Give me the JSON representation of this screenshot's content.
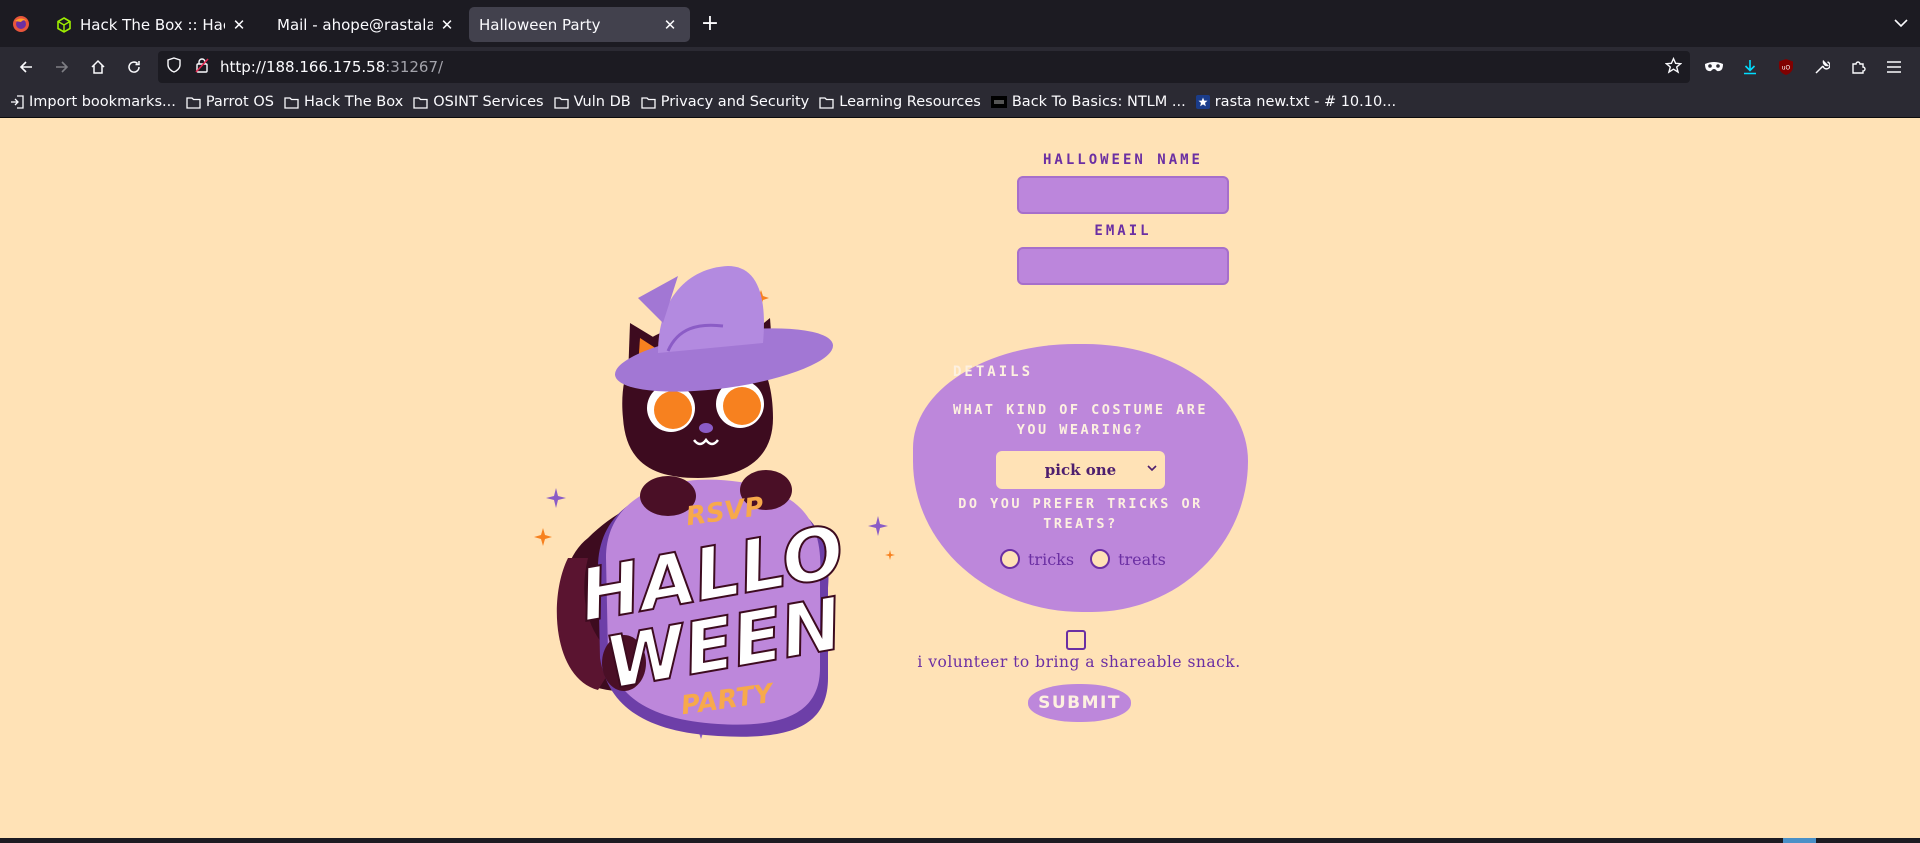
{
  "browser": {
    "tabs": [
      {
        "label": "Hack The Box :: Hack The Box",
        "icon": "hackthebox-cube-icon",
        "active": false
      },
      {
        "label": "Mail - ahope@rastalabs.local",
        "icon": "",
        "active": false
      },
      {
        "label": "Halloween Party",
        "icon": "",
        "active": true
      }
    ],
    "url_host": "http://188.166.175.58",
    "url_rest": ":31267/",
    "bookmarks": [
      {
        "label": "Import bookmarks...",
        "icon": "import-icon"
      },
      {
        "label": "Parrot OS",
        "icon": "folder-icon"
      },
      {
        "label": "Hack The Box",
        "icon": "folder-icon"
      },
      {
        "label": "OSINT Services",
        "icon": "folder-icon"
      },
      {
        "label": "Vuln DB",
        "icon": "folder-icon"
      },
      {
        "label": "Privacy and Security",
        "icon": "folder-icon"
      },
      {
        "label": "Learning Resources",
        "icon": "folder-icon"
      },
      {
        "label": "Back To Basics: NTLM ...",
        "icon": "site-icon"
      },
      {
        "label": "rasta new.txt - # 10.10...",
        "icon": "star-site-icon"
      }
    ]
  },
  "page": {
    "illustration": {
      "rsvp": "RSVP",
      "line1": "HALLO",
      "line2": "WEEN",
      "party": "PARTY"
    },
    "form": {
      "name_label": "HALLOWEEN NAME",
      "email_label": "EMAIL",
      "details_title": "DETAILS",
      "costume_question": "WHAT KIND OF COSTUME ARE YOU WEARING?",
      "costume_selected": "pick one",
      "preference_question": "DO YOU PREFER TRICKS OR TREATS?",
      "radio_options": [
        "tricks",
        "treats"
      ],
      "snack_label": "i volunteer to bring a shareable snack.",
      "submit_label": "SUBMIT"
    },
    "colors": {
      "background": "#ffe2b6",
      "purple": "#bd87db",
      "text_purple": "#6b2fa3",
      "cat": "#3d0b1f",
      "orange": "#f7811f"
    }
  }
}
